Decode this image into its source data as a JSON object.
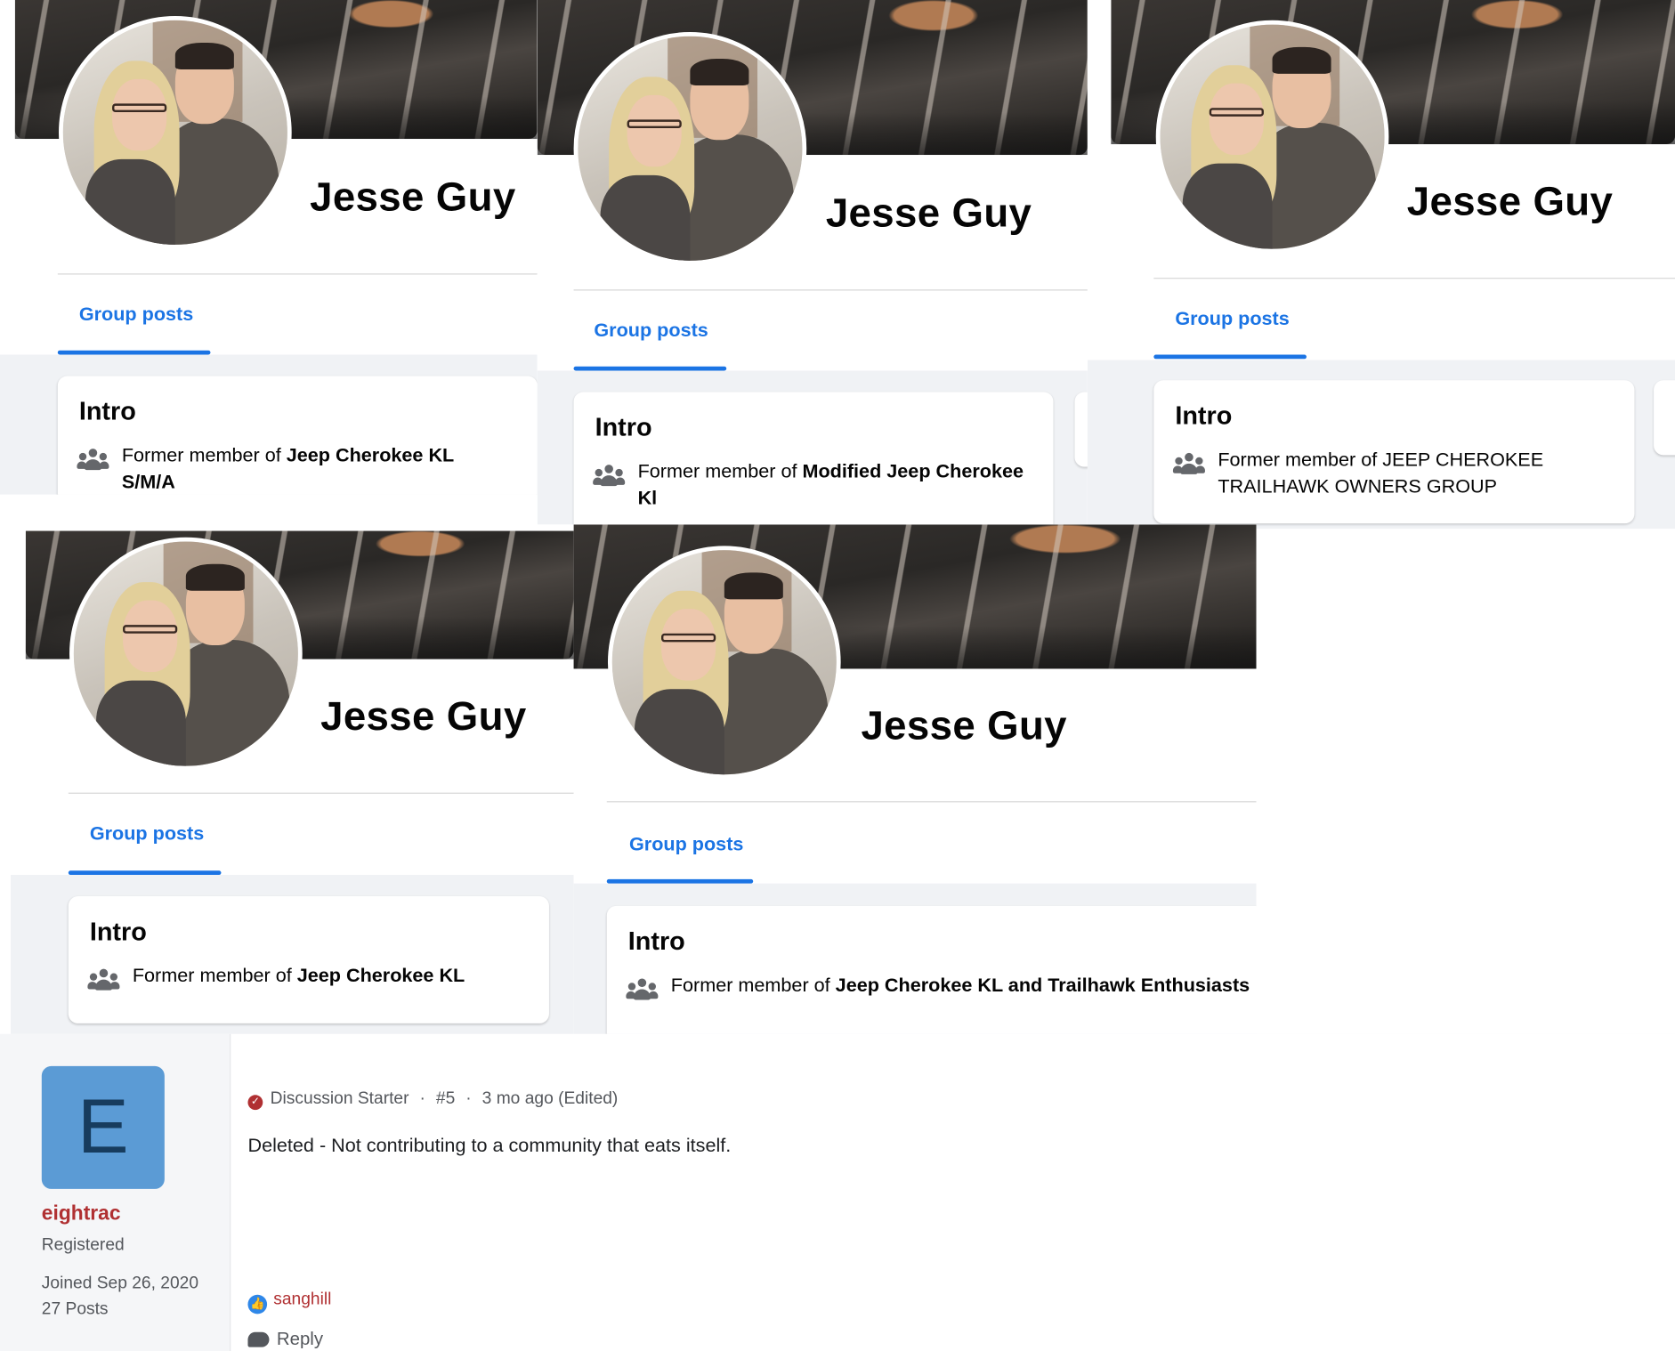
{
  "profiles": [
    {
      "name": "Jesse Guy",
      "tab": "Group posts",
      "intro_title": "Intro",
      "intro_prefix": "Former member of ",
      "group": "Jeep Cherokee KL S/M/A"
    },
    {
      "name": "Jesse Guy",
      "tab": "Group posts",
      "intro_title": "Intro",
      "intro_prefix": "Former member of ",
      "group": "Modified Jeep Cherokee Kl"
    },
    {
      "name": "Jesse Guy",
      "tab": "Group posts",
      "intro_title": "Intro",
      "intro_prefix": "Former member of ",
      "group": "JEEP CHEROKEE TRAILHAWK OWNERS GROUP"
    },
    {
      "name": "Jesse Guy",
      "tab": "Group posts",
      "intro_title": "Intro",
      "intro_prefix": "Former member of ",
      "group": "Jeep Cherokee KL"
    },
    {
      "name": "Jesse Guy",
      "tab": "Group posts",
      "intro_title": "Intro",
      "intro_prefix": "Former member of ",
      "group": "Jeep Cherokee KL and Trailhawk Enthusiasts"
    }
  ],
  "post": {
    "avatar_letter": "E",
    "username": "eightrac",
    "role": "Registered",
    "joined": "Joined Sep 26, 2020",
    "posts": "27 Posts",
    "starter_label": "Discussion Starter",
    "post_number": "#5",
    "time": "3 mo ago (Edited)",
    "text": "Deleted - Not contributing to a community that eats itself.",
    "reaction_user": "sanghill",
    "reply_label": "Reply"
  },
  "icons": {
    "group": "group-icon",
    "starter": "check-circle-icon",
    "like": "thumbs-up-icon",
    "reply": "speech-bubble-icon"
  },
  "colors": {
    "link_blue": "#1b74e4",
    "forum_red": "#b03032",
    "avatar_blue": "#5b9bd5"
  }
}
